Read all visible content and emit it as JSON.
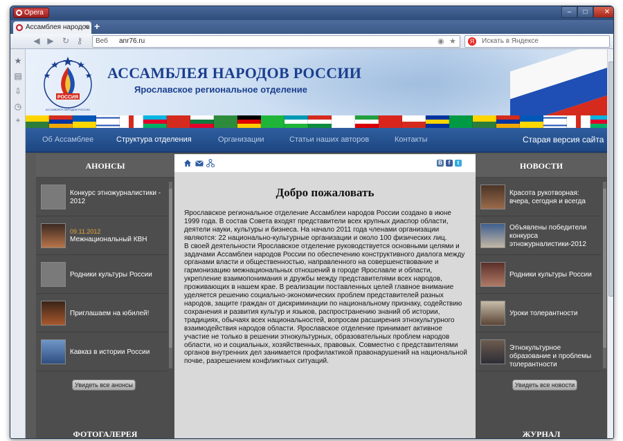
{
  "browser": {
    "app_button": "Opera",
    "tab_title": "Ассамблея народов Р...",
    "tab_close": "×",
    "new_tab": "+",
    "url_prefix": "Веб",
    "url": "anr76.ru",
    "search_placeholder": "Искать в Яндексе",
    "search_engine_letter": "Я"
  },
  "header": {
    "title": "АССАМБЛЕЯ НАРОДОВ РОССИИ",
    "subtitle": "Ярославское региональное отделение",
    "logo_text": "РОССИЯ",
    "logo_ring_text": "АССАМБЛЕЯ НАРОДОВ РОССИИ"
  },
  "menu": {
    "items": [
      "Об Ассамблее",
      "Структура отделения",
      "Организации",
      "Статьи наших авторов",
      "Контакты"
    ],
    "old_version": "Старая версия сайта"
  },
  "announcements": {
    "heading": "АНОНСЫ",
    "items": [
      {
        "date": "",
        "title": "Конкурс этножурналистики - 2012"
      },
      {
        "date": "09.11.2012",
        "title": "Межнациональный КВН"
      },
      {
        "date": "",
        "title": "Родники культуры России"
      },
      {
        "date": "",
        "title": "Приглашаем на юбилей!"
      },
      {
        "date": "",
        "title": "Кавказ в истории России"
      }
    ],
    "all_button": "Увидеть все анонсы",
    "footer_heading": "ФОТОГАЛЕРЕЯ"
  },
  "news": {
    "heading": "НОВОСТИ",
    "items": [
      {
        "title": "Красота рукотворная: вчера, сегодня и всегда"
      },
      {
        "title": "Объявлены победители конкурса этножурналистики-2012"
      },
      {
        "title": "Родники культуры России"
      },
      {
        "title": "Уроки толерантности"
      },
      {
        "title": "Этнокультурное образование и проблемы толерантности"
      }
    ],
    "all_button": "Увидеть все новости",
    "footer_heading": "ЖУРНАЛ"
  },
  "main": {
    "heading": "Добро пожаловать",
    "social": [
      "В",
      "f",
      "t"
    ],
    "paragraphs": [
      "Ярославское региональное отделение Ассамблеи народов России создано в июне 1999 года. В состав Совета входят представители всех крупных диаспор области, деятели науки, культуры и бизнеса. На начало 2011 года членами организации являются: 22 национально-культурные организации и около 100 физических лиц.",
      "В своей деятельности Ярославское отделение руководствуется основными целями и задачами Ассамблеи народов России по обеспечению конструктивного диалога между органами власти и общественностью, направленного на совершенствование и гармонизацию межнациональных отношений в городе Ярославле и области, укрепление взаимопонимания и дружбы между представителями всех народов, проживающих в нашем крае. В реализации поставленных целей главное внимание уделяется решению социально-экономических проблем представителей разных народов, защите граждан от дискриминации по национальному признаку, содействию сохранения и развития культур и языков, распространению знаний об истории, традициях, обычаях всех национальностей, вопросам расширения этнокультурного взаимодействия народов области. Ярославское отделение принимает активное участие не только в решении этнокультурных, образовательных проблем народов области, но и социальных, хозяйственных, правовых. Совместно с представителями органов внутренних дел занимается профилактикой правонарушений на национальной почве, разрешением конфликтных ситуаций."
    ]
  },
  "colors": {
    "menu_blue": "#1e4782",
    "title_blue": "#1b3f8e",
    "column_grey": "#4d4d4d",
    "content_grey": "#d9d9d9",
    "date_orange": "#e3a33a"
  }
}
